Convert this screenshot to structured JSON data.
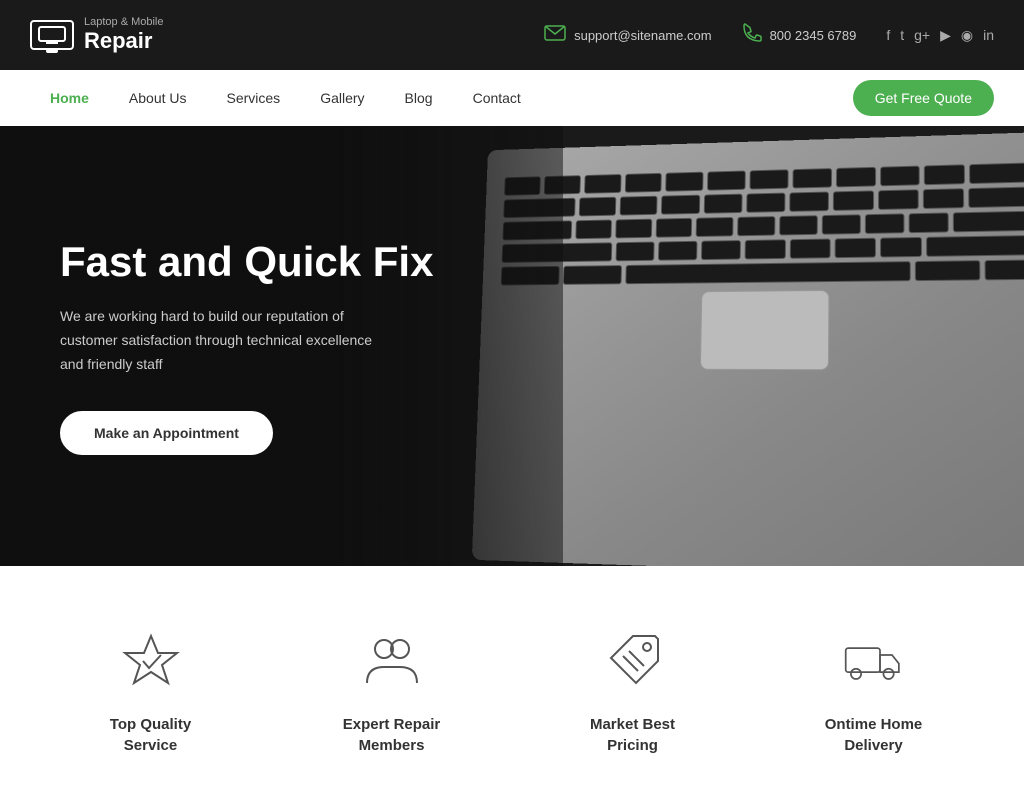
{
  "brand": {
    "tagline": "Laptop & Mobile",
    "name": "Repair"
  },
  "contact": {
    "email_icon": "✉",
    "email": "support@sitename.com",
    "phone_icon": "📞",
    "phone": "800 2345 6789"
  },
  "social": {
    "items": [
      {
        "label": "f",
        "name": "facebook"
      },
      {
        "label": "t",
        "name": "twitter"
      },
      {
        "label": "g+",
        "name": "google-plus"
      },
      {
        "label": "▶",
        "name": "youtube"
      },
      {
        "label": "📷",
        "name": "instagram"
      },
      {
        "label": "in",
        "name": "linkedin"
      }
    ]
  },
  "nav": {
    "links": [
      {
        "label": "Home",
        "active": true
      },
      {
        "label": "About Us",
        "active": false
      },
      {
        "label": "Services",
        "active": false
      },
      {
        "label": "Gallery",
        "active": false
      },
      {
        "label": "Blog",
        "active": false
      },
      {
        "label": "Contact",
        "active": false
      }
    ],
    "cta_label": "Get Free Quote"
  },
  "hero": {
    "title": "Fast and Quick Fix",
    "subtitle": "We are working hard to build our reputation of customer satisfaction through technical excellence and friendly staff",
    "cta_label": "Make an Appointment"
  },
  "features": [
    {
      "title": "Top Quality",
      "subtitle": "Service",
      "icon": "star-check"
    },
    {
      "title": "Expert Repair",
      "subtitle": "Members",
      "icon": "team"
    },
    {
      "title": "Market Best",
      "subtitle": "Pricing",
      "icon": "price-tag"
    },
    {
      "title": "Ontime Home",
      "subtitle": "Delivery",
      "icon": "truck"
    }
  ]
}
